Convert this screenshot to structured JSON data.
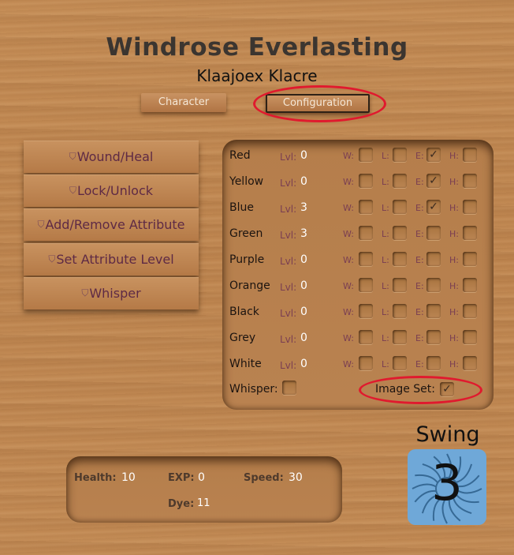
{
  "header": {
    "title": "Windrose Everlasting",
    "subtitle": "Klaajoex Klacre"
  },
  "tabs": [
    {
      "label": "Character"
    },
    {
      "label": "Configuration"
    }
  ],
  "actions": [
    {
      "label": "Wound/Heal"
    },
    {
      "label": "Lock/Unlock"
    },
    {
      "label": "Add/Remove Attribute"
    },
    {
      "label": "Set Attribute Level"
    },
    {
      "label": "Whisper"
    }
  ],
  "attributes": {
    "lvl_label": "Lvl:",
    "flag_labels": {
      "w": "W:",
      "l": "L:",
      "e": "E:",
      "h": "H:"
    },
    "check_mark": "✓",
    "rows": [
      {
        "name": "Red",
        "level": "0",
        "w": false,
        "l": false,
        "e": true,
        "h": false
      },
      {
        "name": "Yellow",
        "level": "0",
        "w": false,
        "l": false,
        "e": true,
        "h": false
      },
      {
        "name": "Blue",
        "level": "3",
        "w": false,
        "l": false,
        "e": true,
        "h": false
      },
      {
        "name": "Green",
        "level": "3",
        "w": false,
        "l": false,
        "e": false,
        "h": false
      },
      {
        "name": "Purple",
        "level": "0",
        "w": false,
        "l": false,
        "e": false,
        "h": false
      },
      {
        "name": "Orange",
        "level": "0",
        "w": false,
        "l": false,
        "e": false,
        "h": false
      },
      {
        "name": "Black",
        "level": "0",
        "w": false,
        "l": false,
        "e": false,
        "h": false
      },
      {
        "name": "Grey",
        "level": "0",
        "w": false,
        "l": false,
        "e": false,
        "h": false
      },
      {
        "name": "White",
        "level": "0",
        "w": false,
        "l": false,
        "e": false,
        "h": false
      }
    ],
    "whisper_label": "Whisper:",
    "whisper_checked": false,
    "image_set_label": "Image Set:",
    "image_set_checked": true
  },
  "stats": {
    "health_label": "Health:",
    "health_value": "10",
    "exp_label": "EXP:",
    "exp_value": "0",
    "speed_label": "Speed:",
    "speed_value": "30",
    "dye_label": "Dye:",
    "dye_value": "11"
  },
  "swing": {
    "label": "Swing",
    "value": "3",
    "card_color": "#6fa8d8",
    "icon": "windrose-star-icon"
  },
  "colors": {
    "highlight_ring": "#e01a2e",
    "accent_text": "#5e2a45"
  }
}
